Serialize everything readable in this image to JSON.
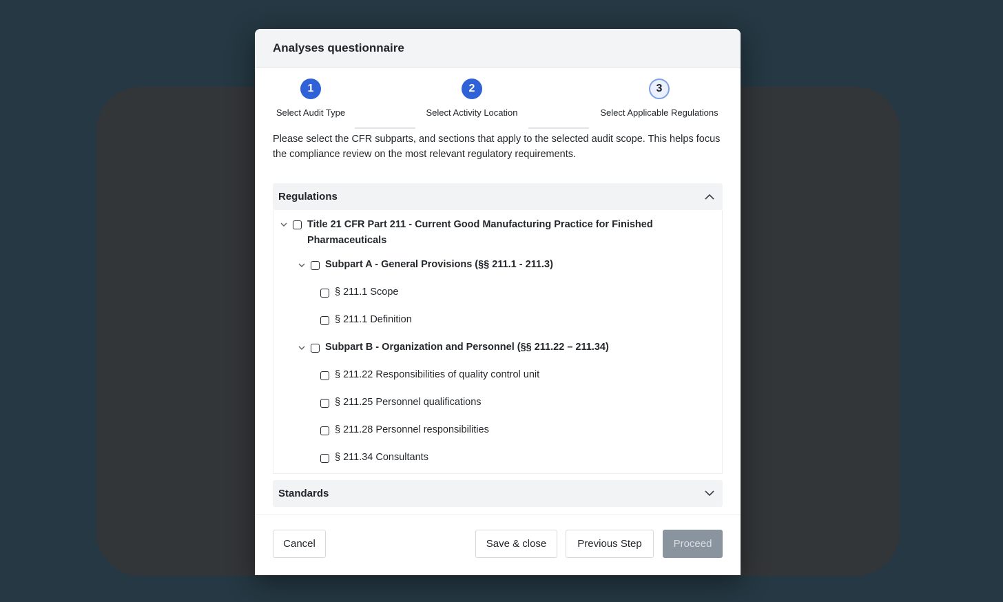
{
  "modal": {
    "title": "Analyses questionnaire"
  },
  "stepper": {
    "steps": [
      {
        "number": "1",
        "label": "Select Audit Type",
        "state": "completed"
      },
      {
        "number": "2",
        "label": "Select Activity Location",
        "state": "completed"
      },
      {
        "number": "3",
        "label": "Select Applicable Regulations",
        "state": "current"
      }
    ]
  },
  "description": "Please select the CFR subparts, and sections that apply to the selected audit scope. This helps focus the compliance review on the most relevant regulatory requirements.",
  "regulations": {
    "title": "Regulations",
    "expanded": true,
    "part": {
      "label_line1": "Title 21 CFR Part 211 - Current Good Manufacturing Practice for Finished",
      "label_line2": "Pharmaceuticals",
      "subparts": [
        {
          "label": "Subpart A - General Provisions (§§ 211.1 - 211.3)",
          "sections": [
            "§ 211.1 Scope",
            "§ 211.1 Definition"
          ]
        },
        {
          "label": "Subpart B - Organization and Personnel (§§ 211.22 – 211.34)",
          "sections": [
            "§ 211.22 Responsibilities of quality control unit",
            "§ 211.25 Personnel qualifications",
            "§ 211.28 Personnel responsibilities",
            "§ 211.34 Consultants"
          ]
        }
      ]
    }
  },
  "standards": {
    "title": "Standards",
    "expanded": false
  },
  "footer": {
    "cancel_label": "Cancel",
    "save_close_label": "Save & close",
    "previous_label": "Previous Step",
    "proceed_label": "Proceed"
  },
  "colors": {
    "backdrop": "#253843",
    "step_active": "#2f62d6",
    "proceed_disabled": "#8a949e"
  }
}
